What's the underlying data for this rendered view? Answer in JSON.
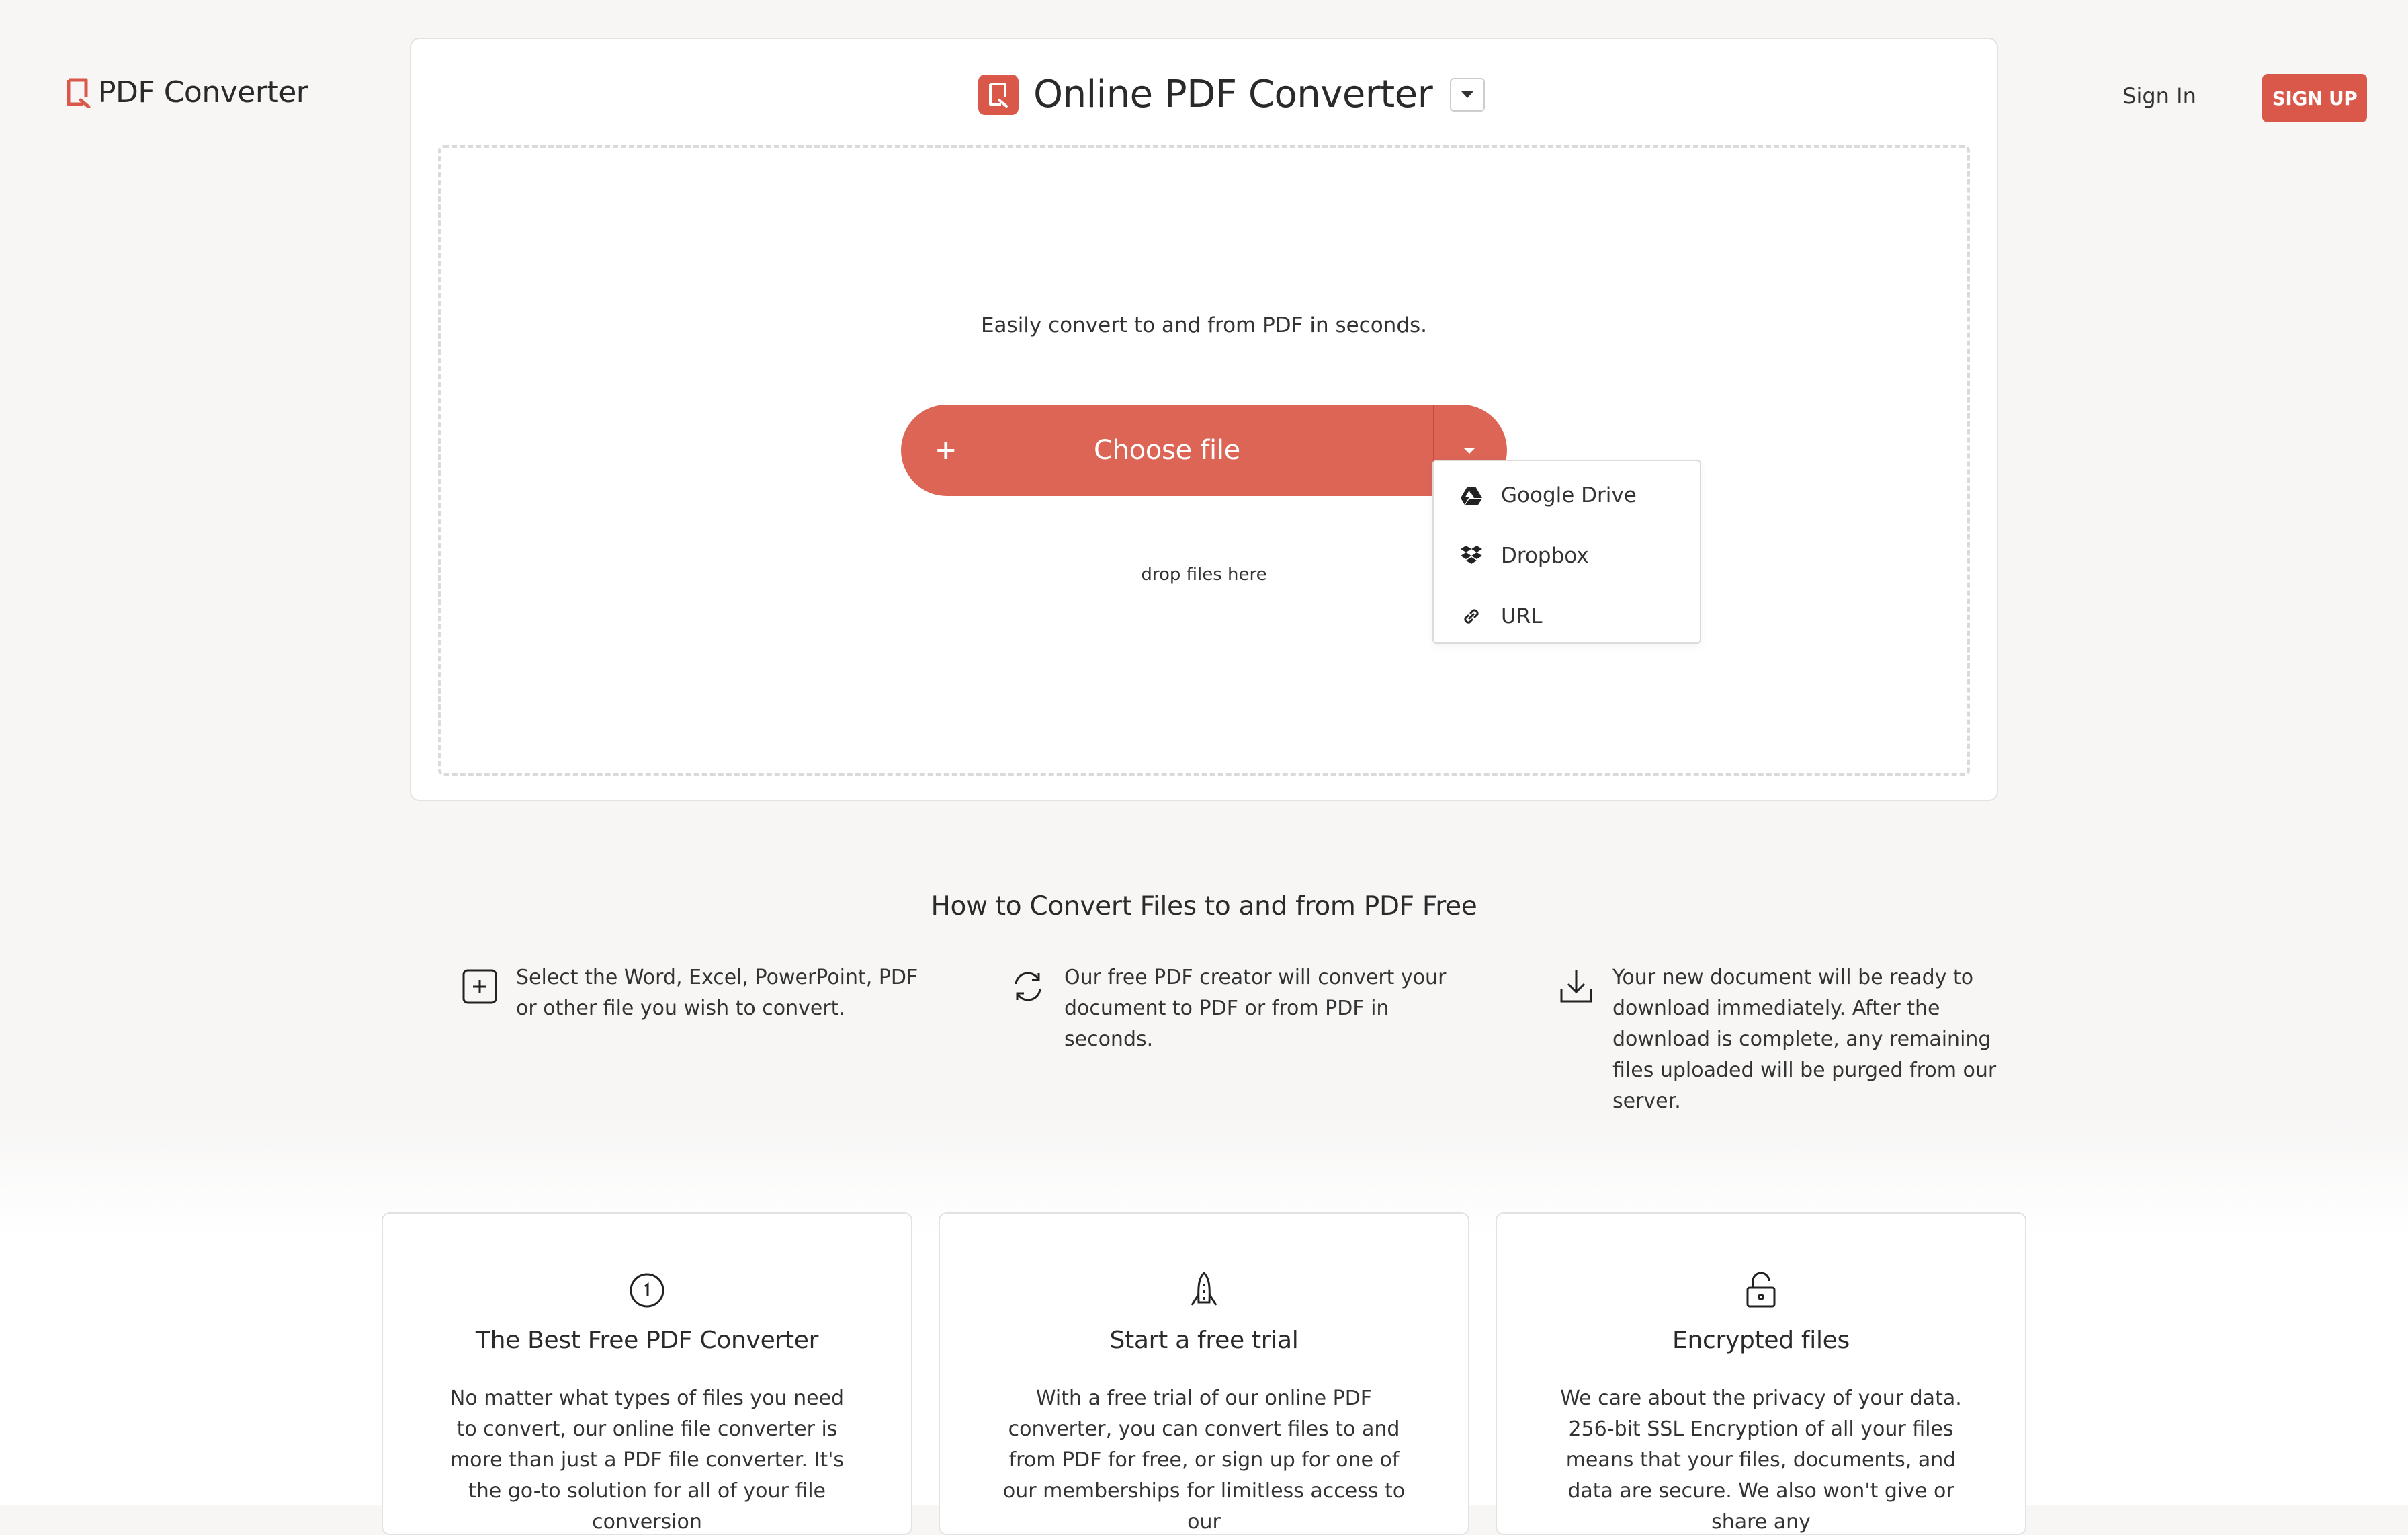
{
  "header": {
    "logo_text": "PDF Converter",
    "signin_label": "Sign In",
    "signup_label": "SIGN UP"
  },
  "converter": {
    "title": "Online PDF Converter",
    "tagline": "Easily convert to and from PDF in seconds.",
    "choose_plus": "+",
    "choose_label": "Choose file",
    "drop_hint": "drop files here",
    "menu": [
      {
        "icon": "google-drive-icon",
        "label": "Google Drive"
      },
      {
        "icon": "dropbox-icon",
        "label": "Dropbox"
      },
      {
        "icon": "link-icon",
        "label": "URL"
      }
    ]
  },
  "howto": {
    "title": "How to Convert Files to and from PDF Free",
    "steps": [
      {
        "icon": "add-file-icon",
        "text": "Select the Word, Excel, PowerPoint, PDF or other file you wish to convert."
      },
      {
        "icon": "convert-arrows-icon",
        "text": "Our free PDF creator will convert your document to PDF or from PDF in seconds."
      },
      {
        "icon": "download-icon",
        "text": "Your new document will be ready to download immediately. After the download is complete, any remaining files uploaded will be purged from our server."
      }
    ]
  },
  "features": [
    {
      "icon": "badge-one-icon",
      "title": "The Best Free PDF Converter",
      "body": "No matter what types of files you need to convert, our online file converter is more than just a PDF file converter. It's the go-to solution for all of your file conversion"
    },
    {
      "icon": "rocket-icon",
      "title": "Start a free trial",
      "body": "With a free trial of our online PDF converter, you can convert files to and from PDF for free, or sign up for one of our memberships for limitless access to our"
    },
    {
      "icon": "lock-icon",
      "title": "Encrypted files",
      "body": "We care about the privacy of your data. 256-bit SSL Encryption of all your files means that your files, documents, and data are secure. We also won't give or share any"
    }
  ],
  "colors": {
    "accent": "#dc6556",
    "accent_dark": "#d9584a",
    "background": "#f7f6f5"
  }
}
